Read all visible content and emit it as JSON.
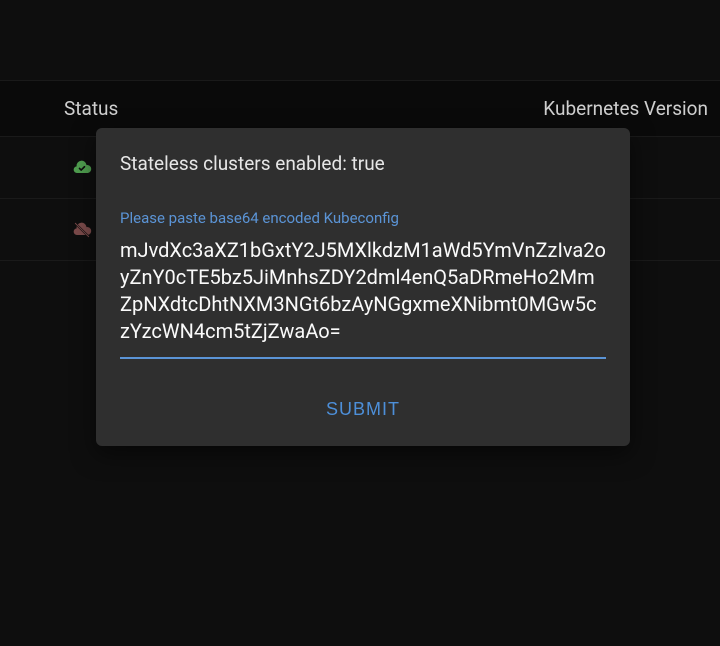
{
  "header": {
    "status_label": "Status",
    "version_label": "Kubernetes Version"
  },
  "rows": [
    {
      "icon": "cloud-check",
      "icon_color": "#4f9e4f"
    },
    {
      "icon": "cloud-off",
      "icon_color": "#7a4a4a"
    }
  ],
  "modal": {
    "title": "Stateless clusters enabled: true",
    "input_label": "Please paste base64 encoded Kubeconfig",
    "input_value": "mJvdXc3aXZ1bGxtY2J5MXlkdzM1aWd5YmVnZzIva2oyZnY0cTE5bz5JiMnhsZDY2dml4enQ5aDRmeHo2MmZpNXdtcDhtNXM3NGt6bzAyNGgxmeXNibmt0MGw5czYzcWN4cm5tZjZwaAo=",
    "submit_label": "SUBMIT"
  }
}
